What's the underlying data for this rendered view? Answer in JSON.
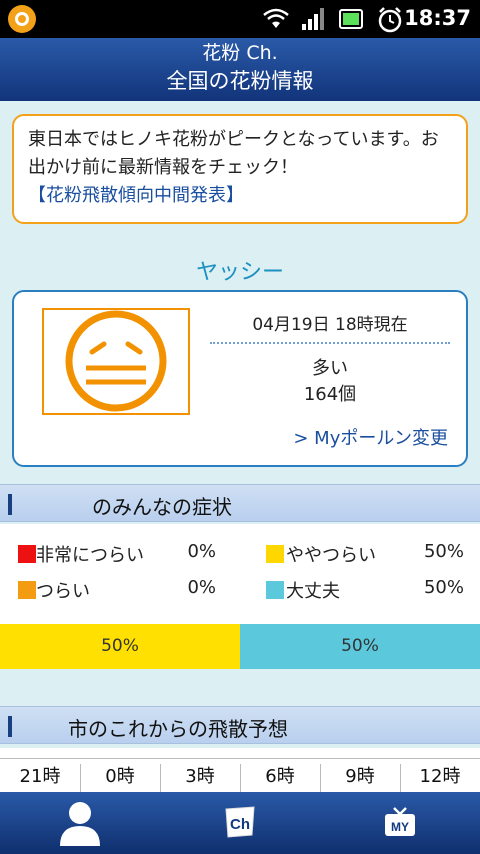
{
  "status_bar": {
    "time": "18:37",
    "icons": [
      "app-logo-icon",
      "wifi-icon",
      "signal-icon",
      "battery-icon",
      "alarm-icon"
    ]
  },
  "header": {
    "subtitle": "花粉 Ch.",
    "title": "全国の花粉情報"
  },
  "notice": {
    "text": "東日本ではヒノキ花粉がピークとなっています。お出かけ前に最新情報をチェック！",
    "link": "【花粉飛散傾向中間発表】"
  },
  "location": {
    "name": "ヤッシー"
  },
  "pollen": {
    "timestamp": "04月19日 18時現在",
    "level": "多い",
    "count": "164個",
    "change_link": "> Myポールン変更",
    "face_icon": "unhappy-face-icon"
  },
  "symptoms_section": {
    "title": "のみんなの症状"
  },
  "symptoms": [
    {
      "label": "非常につらい",
      "value": "0%",
      "color": "#ee1111"
    },
    {
      "label": "ややつらい",
      "value": "50%",
      "color": "#ffd700"
    },
    {
      "label": "つらい",
      "value": "0%",
      "color": "#f39c12"
    },
    {
      "label": "大丈夫",
      "value": "50%",
      "color": "#5bc8dc"
    }
  ],
  "ratio_bar": [
    {
      "label": "50%",
      "fraction": 0.5,
      "color": "#ffe000"
    },
    {
      "label": "50%",
      "fraction": 0.5,
      "color": "#5bc8dc"
    }
  ],
  "forecast_section": {
    "title": "市のこれからの飛散予想"
  },
  "forecast_times": [
    "21時",
    "0時",
    "3時",
    "6時",
    "9時",
    "12時"
  ],
  "bottom_nav": [
    {
      "name": "person-icon"
    },
    {
      "name": "channel-icon",
      "text": "Ch"
    },
    {
      "name": "my-tv-icon",
      "text": "MY"
    }
  ]
}
